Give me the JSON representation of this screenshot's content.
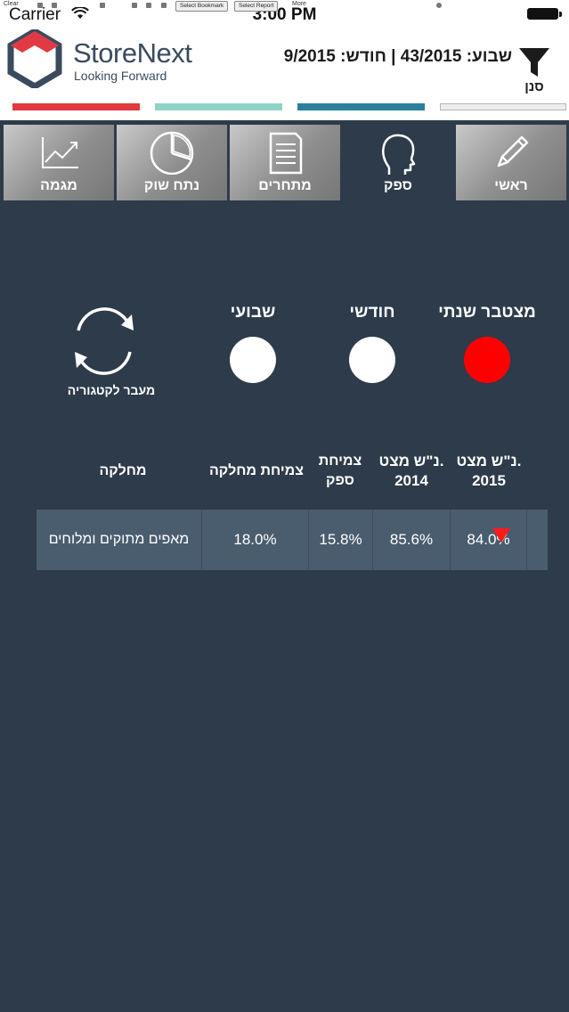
{
  "status_bar": {
    "carrier": "Carrier",
    "time": "3:00 PM"
  },
  "browser_bar": {
    "clear": "Clear",
    "select_bookmark": "Select Bookmark",
    "select_report": "Select Report",
    "more": "More"
  },
  "header": {
    "logo_title": "StoreNext",
    "logo_subtitle": "Looking Forward",
    "period_text": "שבוע: 43/2015 | חודש: 9/2015",
    "filter_label": "סנן"
  },
  "color_strips": [
    {
      "color": "#e0393e"
    },
    {
      "color": "#8fd3c7"
    },
    {
      "color": "#2a7f9e"
    },
    {
      "color": "#ededed"
    }
  ],
  "tabs": [
    {
      "label": "מגמה",
      "icon": "trend-chart-icon",
      "active": false
    },
    {
      "label": "נתח שוק",
      "icon": "pie-chart-icon",
      "active": false
    },
    {
      "label": "מתחרים",
      "icon": "document-icon",
      "active": false
    },
    {
      "label": "ספק",
      "icon": "head-icon",
      "active": true
    },
    {
      "label": "ראשי",
      "icon": "pencil-icon",
      "active": false
    }
  ],
  "period_options": [
    {
      "label": "שבועי",
      "selected": false
    },
    {
      "label": "חודשי",
      "selected": false
    },
    {
      "label": "מצטבר שנתי",
      "selected": true
    }
  ],
  "category_switch": {
    "label": "מעבר לקטגוריה",
    "icon": "refresh-cycle-icon"
  },
  "table": {
    "headers": {
      "department": "מחלקה",
      "dept_growth": "צמיחת מחלקה",
      "supplier_growth_line1": "צמיחת",
      "supplier_growth_line2": "ספק",
      "share_2014_line1": "נ\"ש מצט.",
      "share_2014_line2": "2014",
      "share_2015_line1": "נ\"ש מצט.",
      "share_2015_line2": "2015"
    },
    "rows": [
      {
        "department": "מאפים מתוקים ומלוחים",
        "dept_growth": "18.0%",
        "supplier_growth": "15.8%",
        "share_2014": "85.6%",
        "share_2015": "84.0%",
        "trend": "down",
        "trend_color": "#ff1a1a"
      }
    ]
  },
  "colors": {
    "background": "#2d3b4a",
    "header_bg": "#ffffff",
    "selected_option": "#ff0000",
    "row_bg": "#4a5d6f"
  }
}
